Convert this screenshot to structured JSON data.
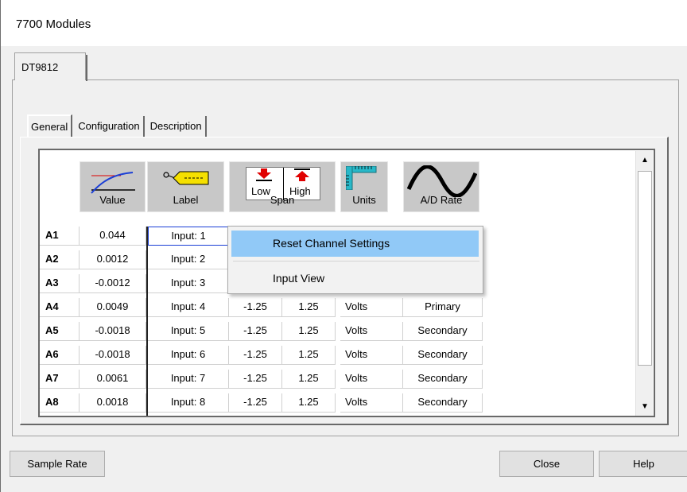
{
  "window": {
    "title": "7700 Modules"
  },
  "outer_tab": "DT9812",
  "inner_tabs": [
    "General",
    "Configuration",
    "Description"
  ],
  "columns": {
    "value": "Value",
    "label": "Label",
    "span_low": "Low",
    "span_high": "High",
    "span": "Span",
    "units": "Units",
    "ad_rate": "A/D Rate"
  },
  "rows": [
    {
      "name": "A1",
      "value": "0.044",
      "label": "Input: 1",
      "low": "",
      "high": "",
      "units": "",
      "rate": ""
    },
    {
      "name": "A2",
      "value": "0.0012",
      "label": "Input: 2",
      "low": "",
      "high": "",
      "units": "",
      "rate": ""
    },
    {
      "name": "A3",
      "value": "-0.0012",
      "label": "Input: 3",
      "low": "",
      "high": "",
      "units": "",
      "rate": ""
    },
    {
      "name": "A4",
      "value": "0.0049",
      "label": "Input: 4",
      "low": "-1.25",
      "high": "1.25",
      "units": "Volts",
      "rate": "Primary"
    },
    {
      "name": "A5",
      "value": "-0.0018",
      "label": "Input: 5",
      "low": "-1.25",
      "high": "1.25",
      "units": "Volts",
      "rate": "Secondary"
    },
    {
      "name": "A6",
      "value": "-0.0018",
      "label": "Input: 6",
      "low": "-1.25",
      "high": "1.25",
      "units": "Volts",
      "rate": "Secondary"
    },
    {
      "name": "A7",
      "value": "0.0061",
      "label": "Input: 7",
      "low": "-1.25",
      "high": "1.25",
      "units": "Volts",
      "rate": "Secondary"
    },
    {
      "name": "A8",
      "value": "0.0018",
      "label": "Input: 8",
      "low": "-1.25",
      "high": "1.25",
      "units": "Volts",
      "rate": "Secondary"
    }
  ],
  "context_menu": {
    "items": [
      "Reset Channel Settings",
      "Input View"
    ]
  },
  "buttons": {
    "sample_rate": "Sample Rate",
    "close": "Close",
    "help": "Help"
  },
  "colors": {
    "menu_highlight": "#91c9f7",
    "header_bg": "#c8c8c8",
    "label_icon": "#f5e000"
  }
}
